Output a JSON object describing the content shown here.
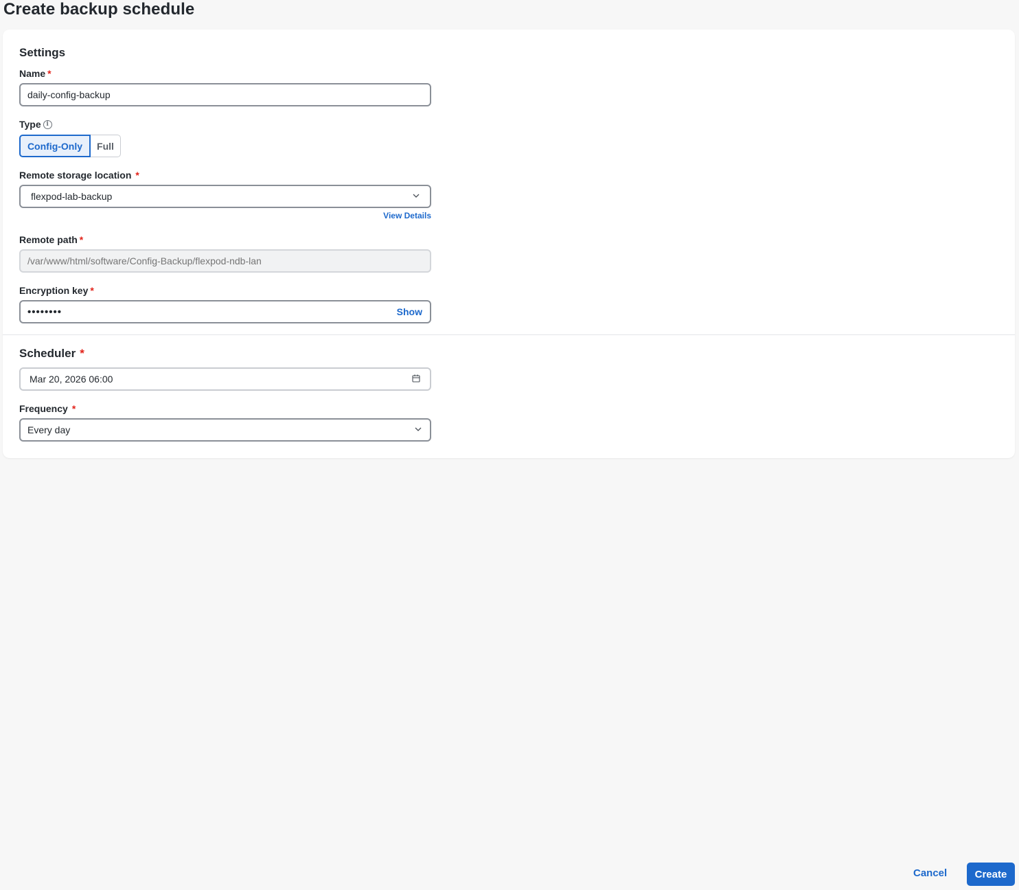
{
  "page": {
    "title": "Create backup schedule"
  },
  "settings": {
    "section_title": "Settings",
    "name": {
      "label": "Name",
      "value": "daily-config-backup"
    },
    "type": {
      "label": "Type",
      "options": [
        "Config-Only",
        "Full"
      ],
      "selected": "Config-Only"
    },
    "remote_storage": {
      "label": "Remote storage location",
      "value": "flexpod-lab-backup",
      "view_details": "View Details"
    },
    "remote_path": {
      "label": "Remote path",
      "placeholder": "/var/www/html/software/Config-Backup/flexpod-ndb-lan"
    },
    "encryption_key": {
      "label": "Encryption key",
      "masked_value": "••••••••",
      "show_label": "Show"
    }
  },
  "scheduler": {
    "section_title": "Scheduler",
    "date": {
      "value": "Mar 20, 2026 06:00"
    },
    "frequency": {
      "label": "Frequency",
      "value": "Every day"
    }
  },
  "footer": {
    "cancel_label": "Cancel",
    "create_label": "Create"
  },
  "colors": {
    "accent": "#1d69cc",
    "required": "#e2231a"
  },
  "required_marker": "*",
  "icons": {
    "info": "info-icon",
    "dropdown": "chevron-down-icon",
    "calendar": "calendar-icon"
  }
}
